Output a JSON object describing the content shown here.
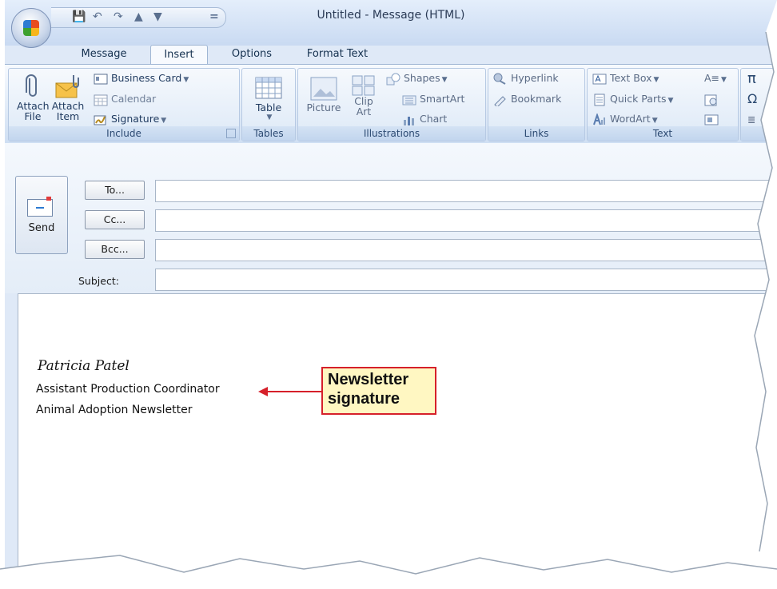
{
  "window": {
    "title": "Untitled - Message (HTML)"
  },
  "quick_access": {
    "icons": [
      "save-icon",
      "undo-icon",
      "redo-icon",
      "previous-icon",
      "next-icon",
      "customize-icon"
    ],
    "customize_glyph": "="
  },
  "tabs": [
    {
      "label": "Message",
      "active": false
    },
    {
      "label": "Insert",
      "active": true
    },
    {
      "label": "Options",
      "active": false
    },
    {
      "label": "Format Text",
      "active": false
    }
  ],
  "ribbon": {
    "include": {
      "label": "Include",
      "attach_file": [
        "Attach",
        "File"
      ],
      "attach_item": [
        "Attach",
        "Item"
      ],
      "business_card": "Business Card",
      "calendar": "Calendar",
      "signature": "Signature"
    },
    "tables": {
      "label": "Tables",
      "table": "Table"
    },
    "illustrations": {
      "label": "Illustrations",
      "picture": "Picture",
      "clip_art": [
        "Clip",
        "Art"
      ],
      "shapes": "Shapes",
      "smartart": "SmartArt",
      "chart": "Chart"
    },
    "links": {
      "label": "Links",
      "hyperlink": "Hyperlink",
      "bookmark": "Bookmark"
    },
    "text": {
      "label": "Text",
      "text_box": "Text Box",
      "quick_parts": "Quick Parts",
      "wordart": "WordArt"
    },
    "symbols": {
      "glyphs": [
        "π",
        "Ω"
      ]
    }
  },
  "compose": {
    "send": "Send",
    "to": "To...",
    "cc": "Cc...",
    "bcc": "Bcc...",
    "subject": "Subject:",
    "to_value": "",
    "cc_value": "",
    "bcc_value": "",
    "subject_value": ""
  },
  "signature": {
    "name": "Patricia Patel",
    "title": "Assistant Production Coordinator",
    "organization": "Animal Adoption Newsletter"
  },
  "callout": {
    "line1": "Newsletter",
    "line2": "signature",
    "color": "#d6202a",
    "fill": "#fff7c2"
  }
}
